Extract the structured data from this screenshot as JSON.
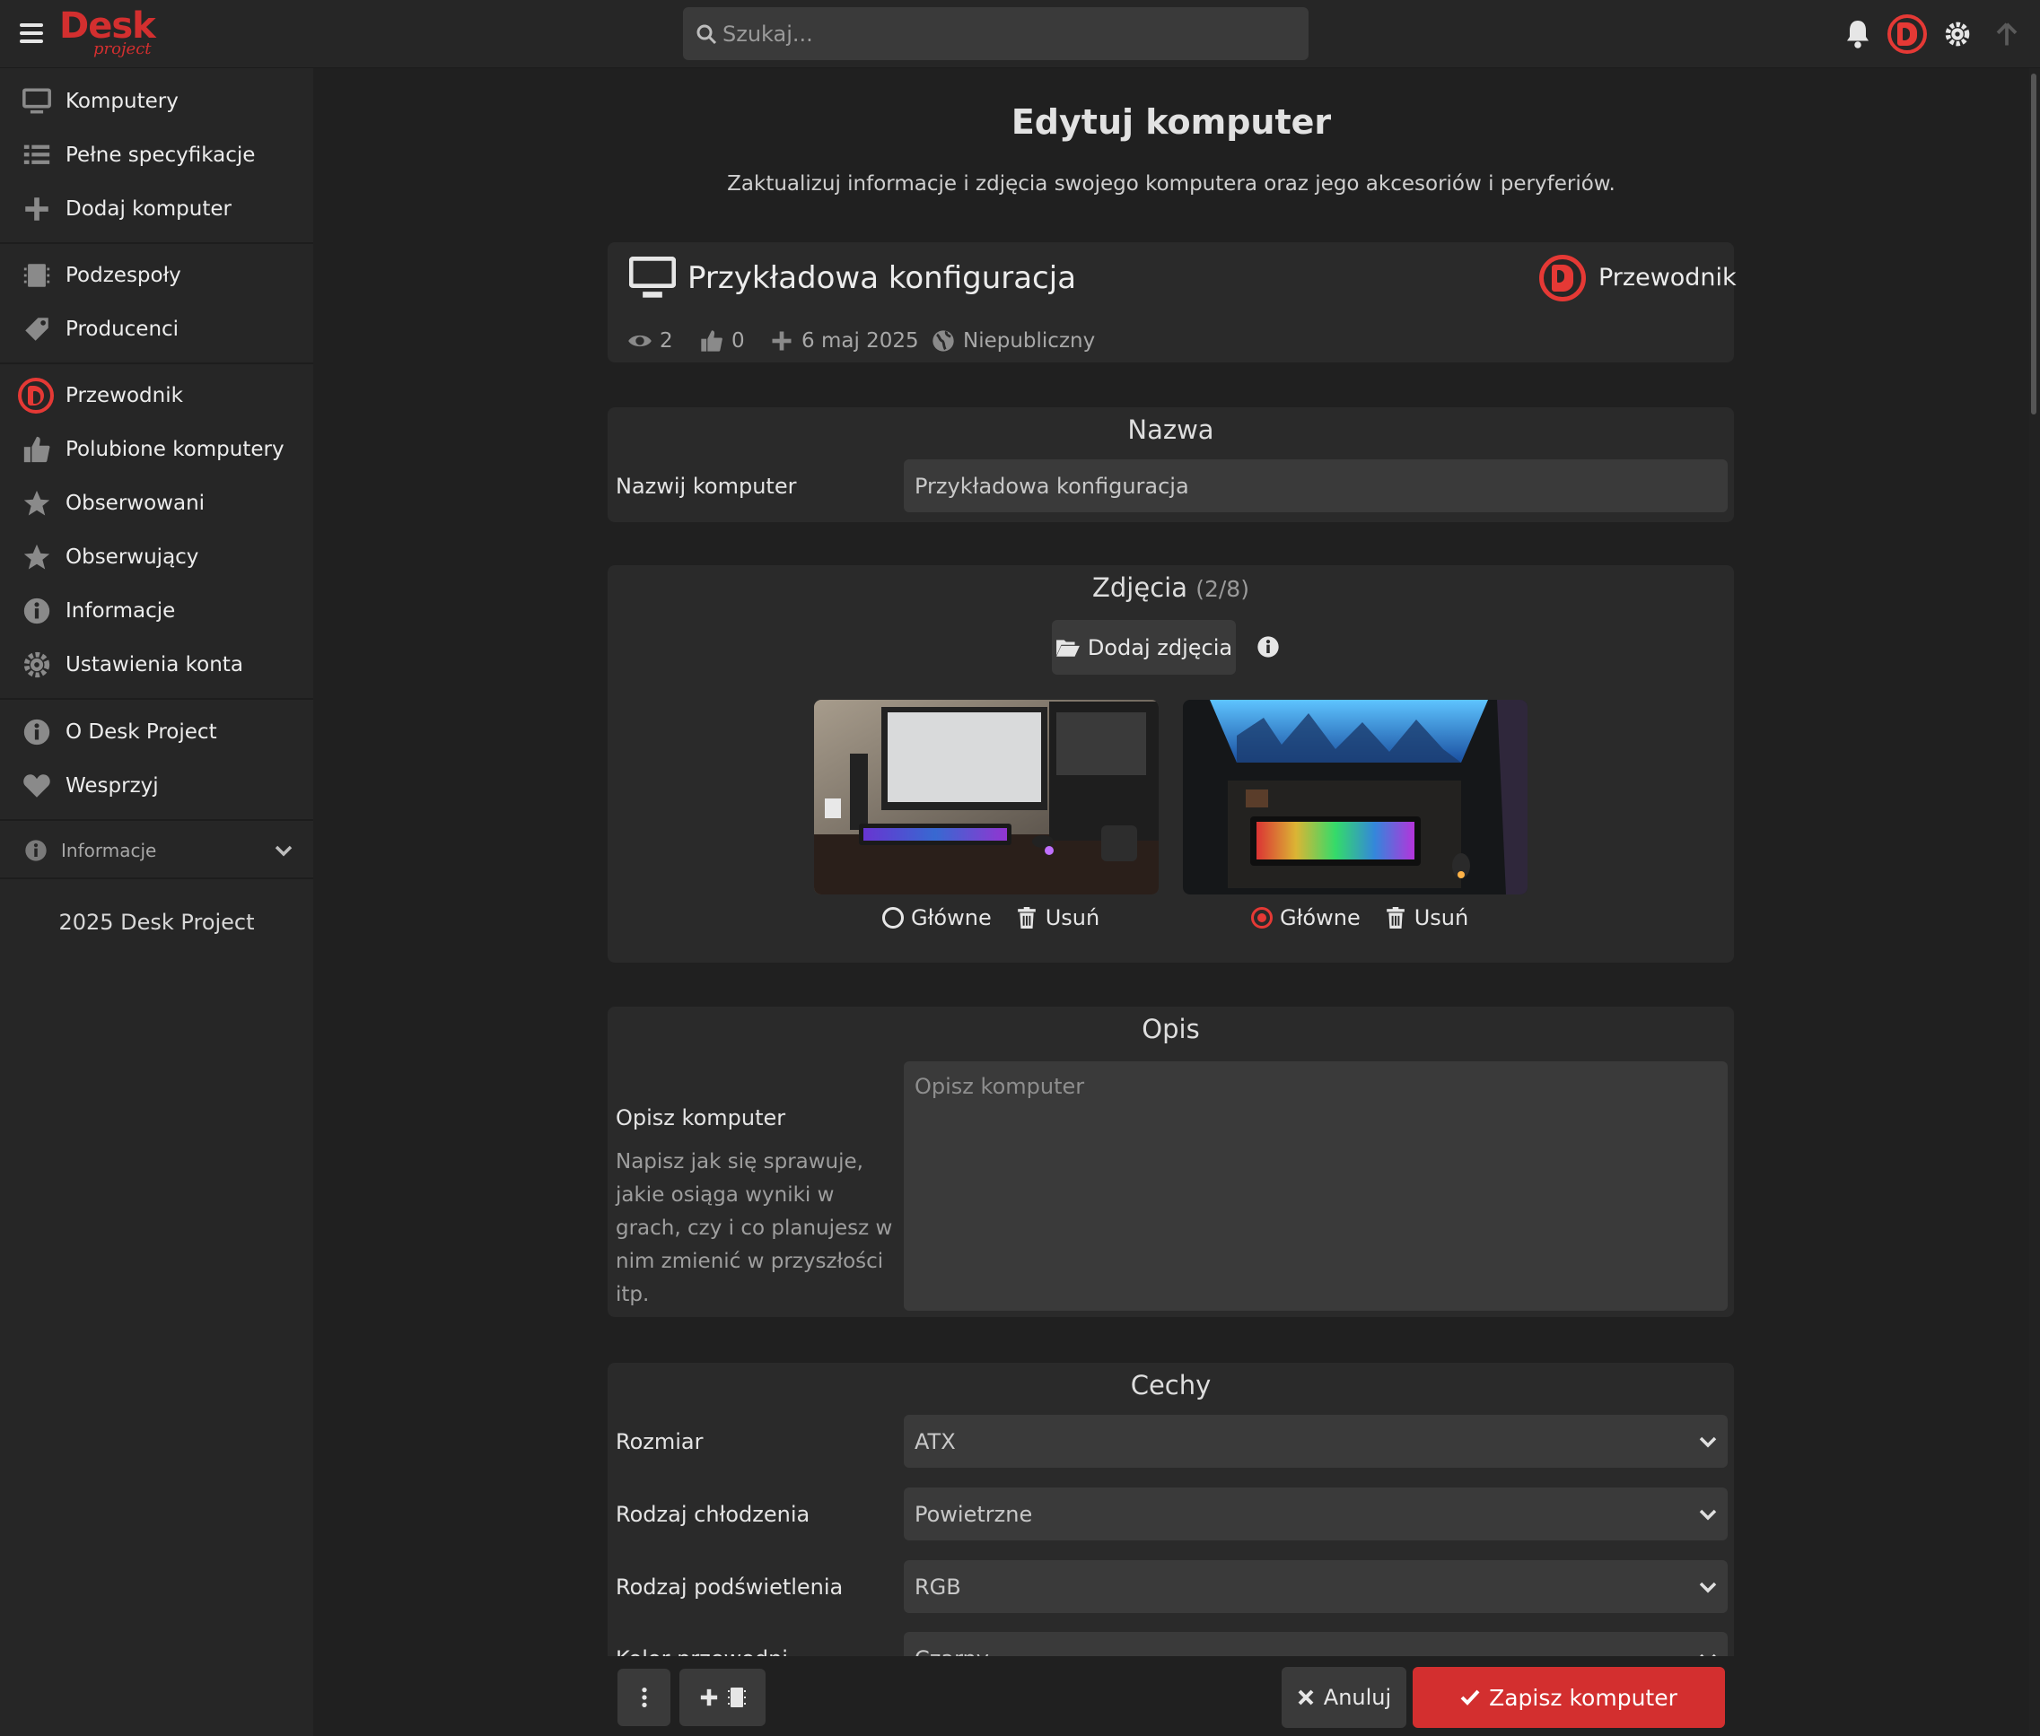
{
  "topbar": {
    "logo_main": "Desk",
    "logo_sub": "project",
    "search_placeholder": "Szukaj..."
  },
  "sidebar": {
    "items": [
      {
        "label": "Komputery",
        "icon": "monitor-icon"
      },
      {
        "label": "Pełne specyfikacje",
        "icon": "list-icon"
      },
      {
        "label": "Dodaj komputer",
        "icon": "plus-icon"
      },
      {
        "label": "Podzespoły",
        "icon": "chip-icon"
      },
      {
        "label": "Producenci",
        "icon": "tag-icon"
      },
      {
        "label": "Przewodnik",
        "icon": "avatar-icon"
      },
      {
        "label": "Polubione komputery",
        "icon": "thumbs-up-icon"
      },
      {
        "label": "Obserwowani",
        "icon": "star-icon"
      },
      {
        "label": "Obserwujący",
        "icon": "star-icon"
      },
      {
        "label": "Informacje",
        "icon": "info-icon"
      },
      {
        "label": "Ustawienia konta",
        "icon": "gear-icon"
      },
      {
        "label": "O Desk Project",
        "icon": "info-icon"
      },
      {
        "label": "Wesprzyj",
        "icon": "heart-icon"
      }
    ],
    "collapsible_label": "Informacje",
    "footer": "2025 Desk Project"
  },
  "page": {
    "title": "Edytuj komputer",
    "subtitle": "Zaktualizuj informacje i zdjęcia swojego komputera oraz jego akcesoriów i peryferiów."
  },
  "computer": {
    "name": "Przykładowa konfiguracja",
    "owner": "Przewodnik",
    "views": "2",
    "likes": "0",
    "date": "6 maj 2025",
    "visibility": "Niepubliczny"
  },
  "name_section": {
    "title": "Nazwa",
    "label": "Nazwij komputer",
    "value": "Przykładowa konfiguracja"
  },
  "photos_section": {
    "title": "Zdjęcia",
    "count": "(2/8)",
    "add_button": "Dodaj zdjęcia",
    "main_label": "Główne",
    "delete_label": "Usuń",
    "photos": [
      {
        "is_main": false
      },
      {
        "is_main": true
      }
    ]
  },
  "description_section": {
    "title": "Opis",
    "label": "Opisz komputer",
    "help": "Napisz jak się sprawuje, jakie osiąga wyniki w grach, czy i co planujesz w nim zmienić w przyszłości itp.",
    "placeholder": "Opisz komputer"
  },
  "features_section": {
    "title": "Cechy",
    "rows": [
      {
        "label": "Rozmiar",
        "value": "ATX"
      },
      {
        "label": "Rodzaj chłodzenia",
        "value": "Powietrzne"
      },
      {
        "label": "Rodzaj podświetlenia",
        "value": "RGB"
      },
      {
        "label": "Kolor przewodni",
        "value": "Czarny"
      }
    ]
  },
  "actions": {
    "cancel": "Anuluj",
    "save": "Zapisz komputer"
  },
  "colors": {
    "accent": "#d32f2f",
    "background": "#202020",
    "panel": "#2a2a2a",
    "input": "#3a3a3a"
  }
}
